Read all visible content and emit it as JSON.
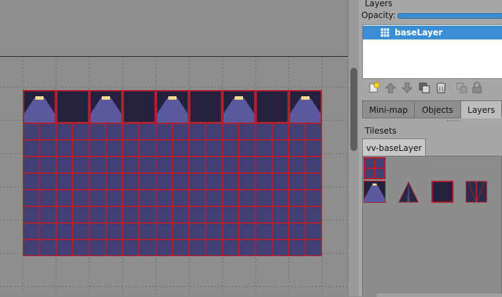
{
  "map": {
    "tiles_across": 9,
    "light_tile_columns": [
      0,
      2,
      4,
      6,
      8
    ],
    "colors": {
      "canvas_bg": "#8e8e8e",
      "tile_fill": "#413f73",
      "tile_dark": "#24203e",
      "tile_border": "#b1212d",
      "light_cone": "#5b5aa0",
      "lamp": "#f3d98b",
      "grid_dots": "#6a6a6a"
    }
  },
  "layers_panel": {
    "title": "Layers",
    "opacity_label": "Opacity:",
    "opacity_value": 1.0,
    "selected_layer": "baseLayer",
    "toolbar_icons": [
      "new-layer-icon",
      "move-up-icon",
      "move-down-icon",
      "duplicate-layer-icon",
      "delete-layer-icon",
      "merge-layer-icon",
      "lock-layer-icon"
    ]
  },
  "tabs": [
    {
      "label": "Mini-map",
      "active": false
    },
    {
      "label": "Objects",
      "active": false
    },
    {
      "label": "Layers",
      "active": true
    }
  ],
  "tilesets": {
    "title": "Tilesets",
    "tab_label": "vv-baseLayer",
    "tile_icons": [
      "grid-tile",
      "light-tile",
      "pyramid-tile",
      "dark-square-tile",
      "triangle-split-tile"
    ]
  }
}
